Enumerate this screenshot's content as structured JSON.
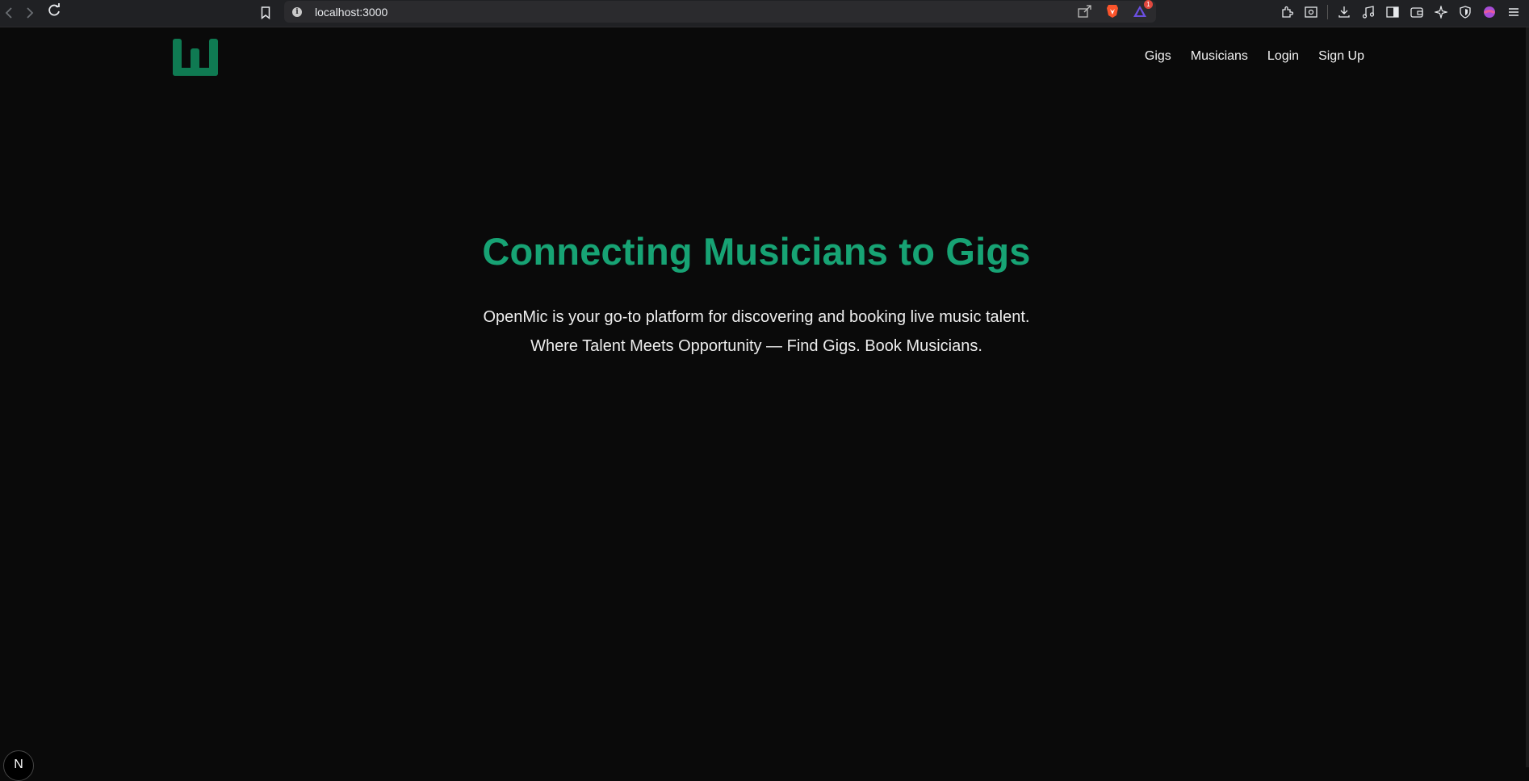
{
  "browser": {
    "url": "localhost:3000",
    "notification_count": "1"
  },
  "header": {
    "nav": [
      {
        "label": "Gigs"
      },
      {
        "label": "Musicians"
      },
      {
        "label": "Login"
      },
      {
        "label": "Sign Up"
      }
    ]
  },
  "hero": {
    "title": "Connecting Musicians to Gigs",
    "description": "OpenMic is your go-to platform for discovering and booking live music talent.",
    "tagline": "Where Talent Meets Opportunity — Find Gigs. Book Musicians."
  },
  "dev_badge": {
    "label": "N"
  },
  "colors": {
    "background": "#0a0a0a",
    "accent": "#17a374",
    "logo": "#0f7a52",
    "text": "#ededed"
  }
}
